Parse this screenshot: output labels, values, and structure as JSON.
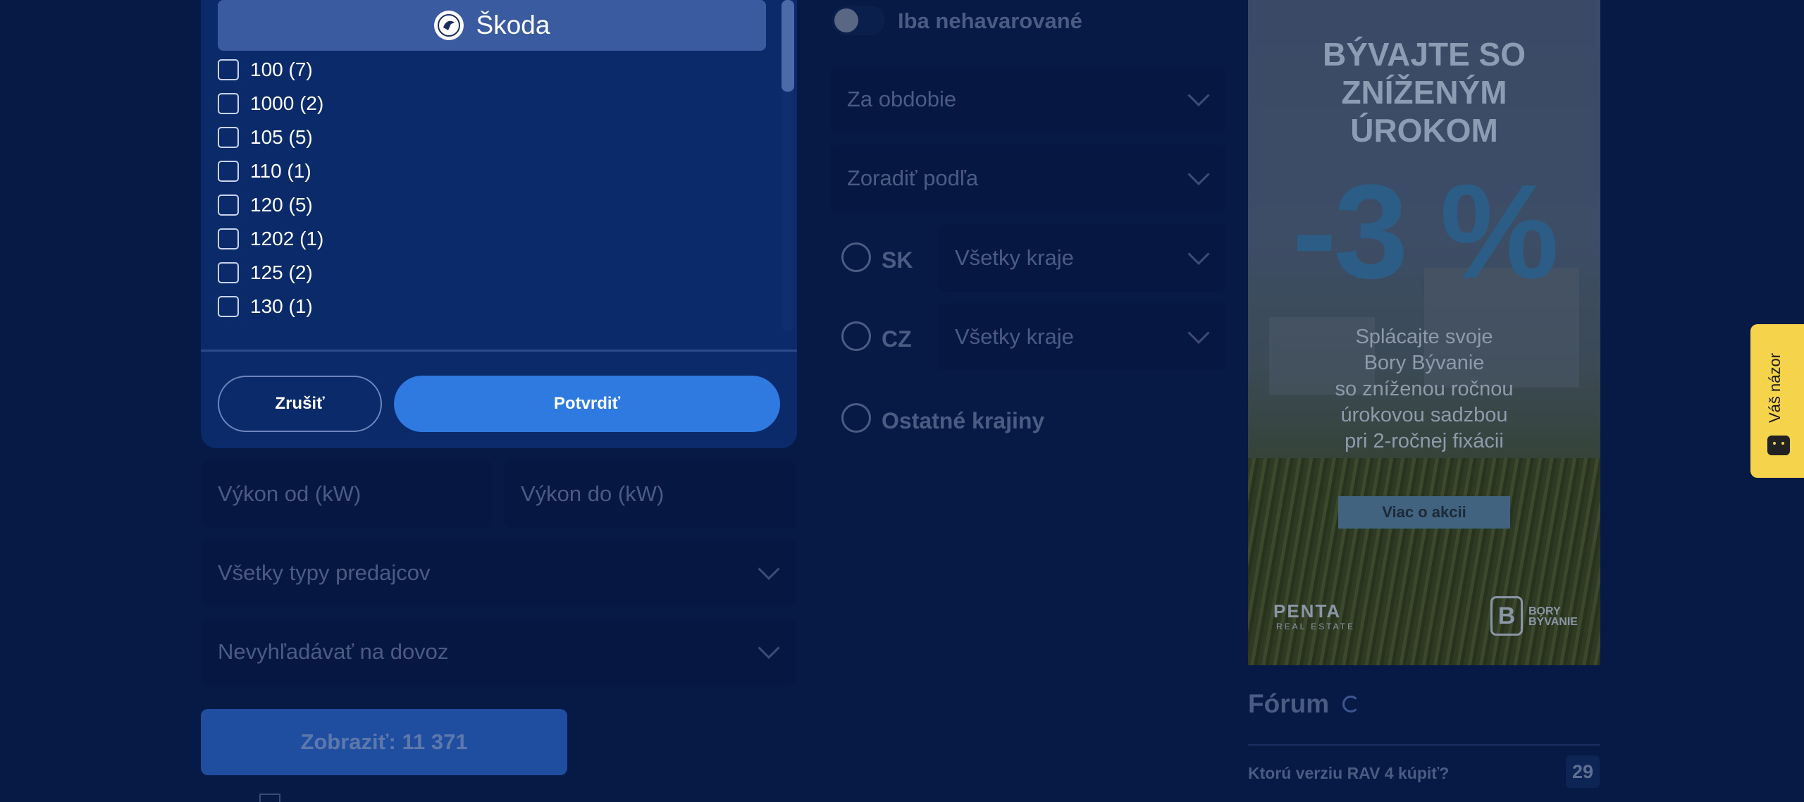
{
  "brand_popup": {
    "brand_name": "Škoda",
    "models": [
      {
        "label": "100 (7)"
      },
      {
        "label": "1000 (2)"
      },
      {
        "label": "105 (5)"
      },
      {
        "label": "110 (1)"
      },
      {
        "label": "120 (5)"
      },
      {
        "label": "1202 (1)"
      },
      {
        "label": "125 (2)"
      },
      {
        "label": "130 (1)"
      }
    ],
    "cancel_label": "Zrušiť",
    "confirm_label": "Potvrdiť"
  },
  "filters": {
    "power_from_placeholder": "Výkon od (kW)",
    "power_to_placeholder": "Výkon do (kW)",
    "seller_type": "Všetky typy predajcov",
    "import": "Nevyhľadávať na dovoz",
    "show_button": "Zobraziť: 11 371",
    "undamaged_toggle": "Iba nehavarované",
    "period": "Za obdobie",
    "sort_by": "Zoradiť podľa",
    "region_sk_label": "SK",
    "region_sk_select": "Všetky kraje",
    "region_cz_label": "CZ",
    "region_cz_select": "Všetky kraje",
    "region_other_label": "Ostatné krajiny"
  },
  "ad": {
    "headline_1": "BÝVAJTE SO",
    "headline_2": "ZNÍŽENÝM",
    "headline_3": "ÚROKOM",
    "percent": "-3 %",
    "body_1": "Splácajte svoje",
    "body_2": "Bory Bývanie",
    "body_3": "so zníženou ročnou",
    "body_4": "úrokovou sadzbou",
    "body_5": "pri 2-ročnej fixácii",
    "button": "Viac o akcii",
    "logo_left": "PENTA",
    "logo_left_sub": "REAL ESTATE",
    "logo_right_1": "BORY",
    "logo_right_2": "BÝVANIE"
  },
  "forum": {
    "title": "Fórum",
    "item_title": "Ktorú verziu RAV 4 kúpiť?",
    "item_count": "29"
  },
  "feedback": {
    "label": "Váš názor"
  },
  "colors": {
    "page_bg": "#071a45",
    "popup_bg": "#0b2a6a",
    "confirm_button": "#2e7ae0",
    "feedback_tab": "#f5d34a"
  }
}
